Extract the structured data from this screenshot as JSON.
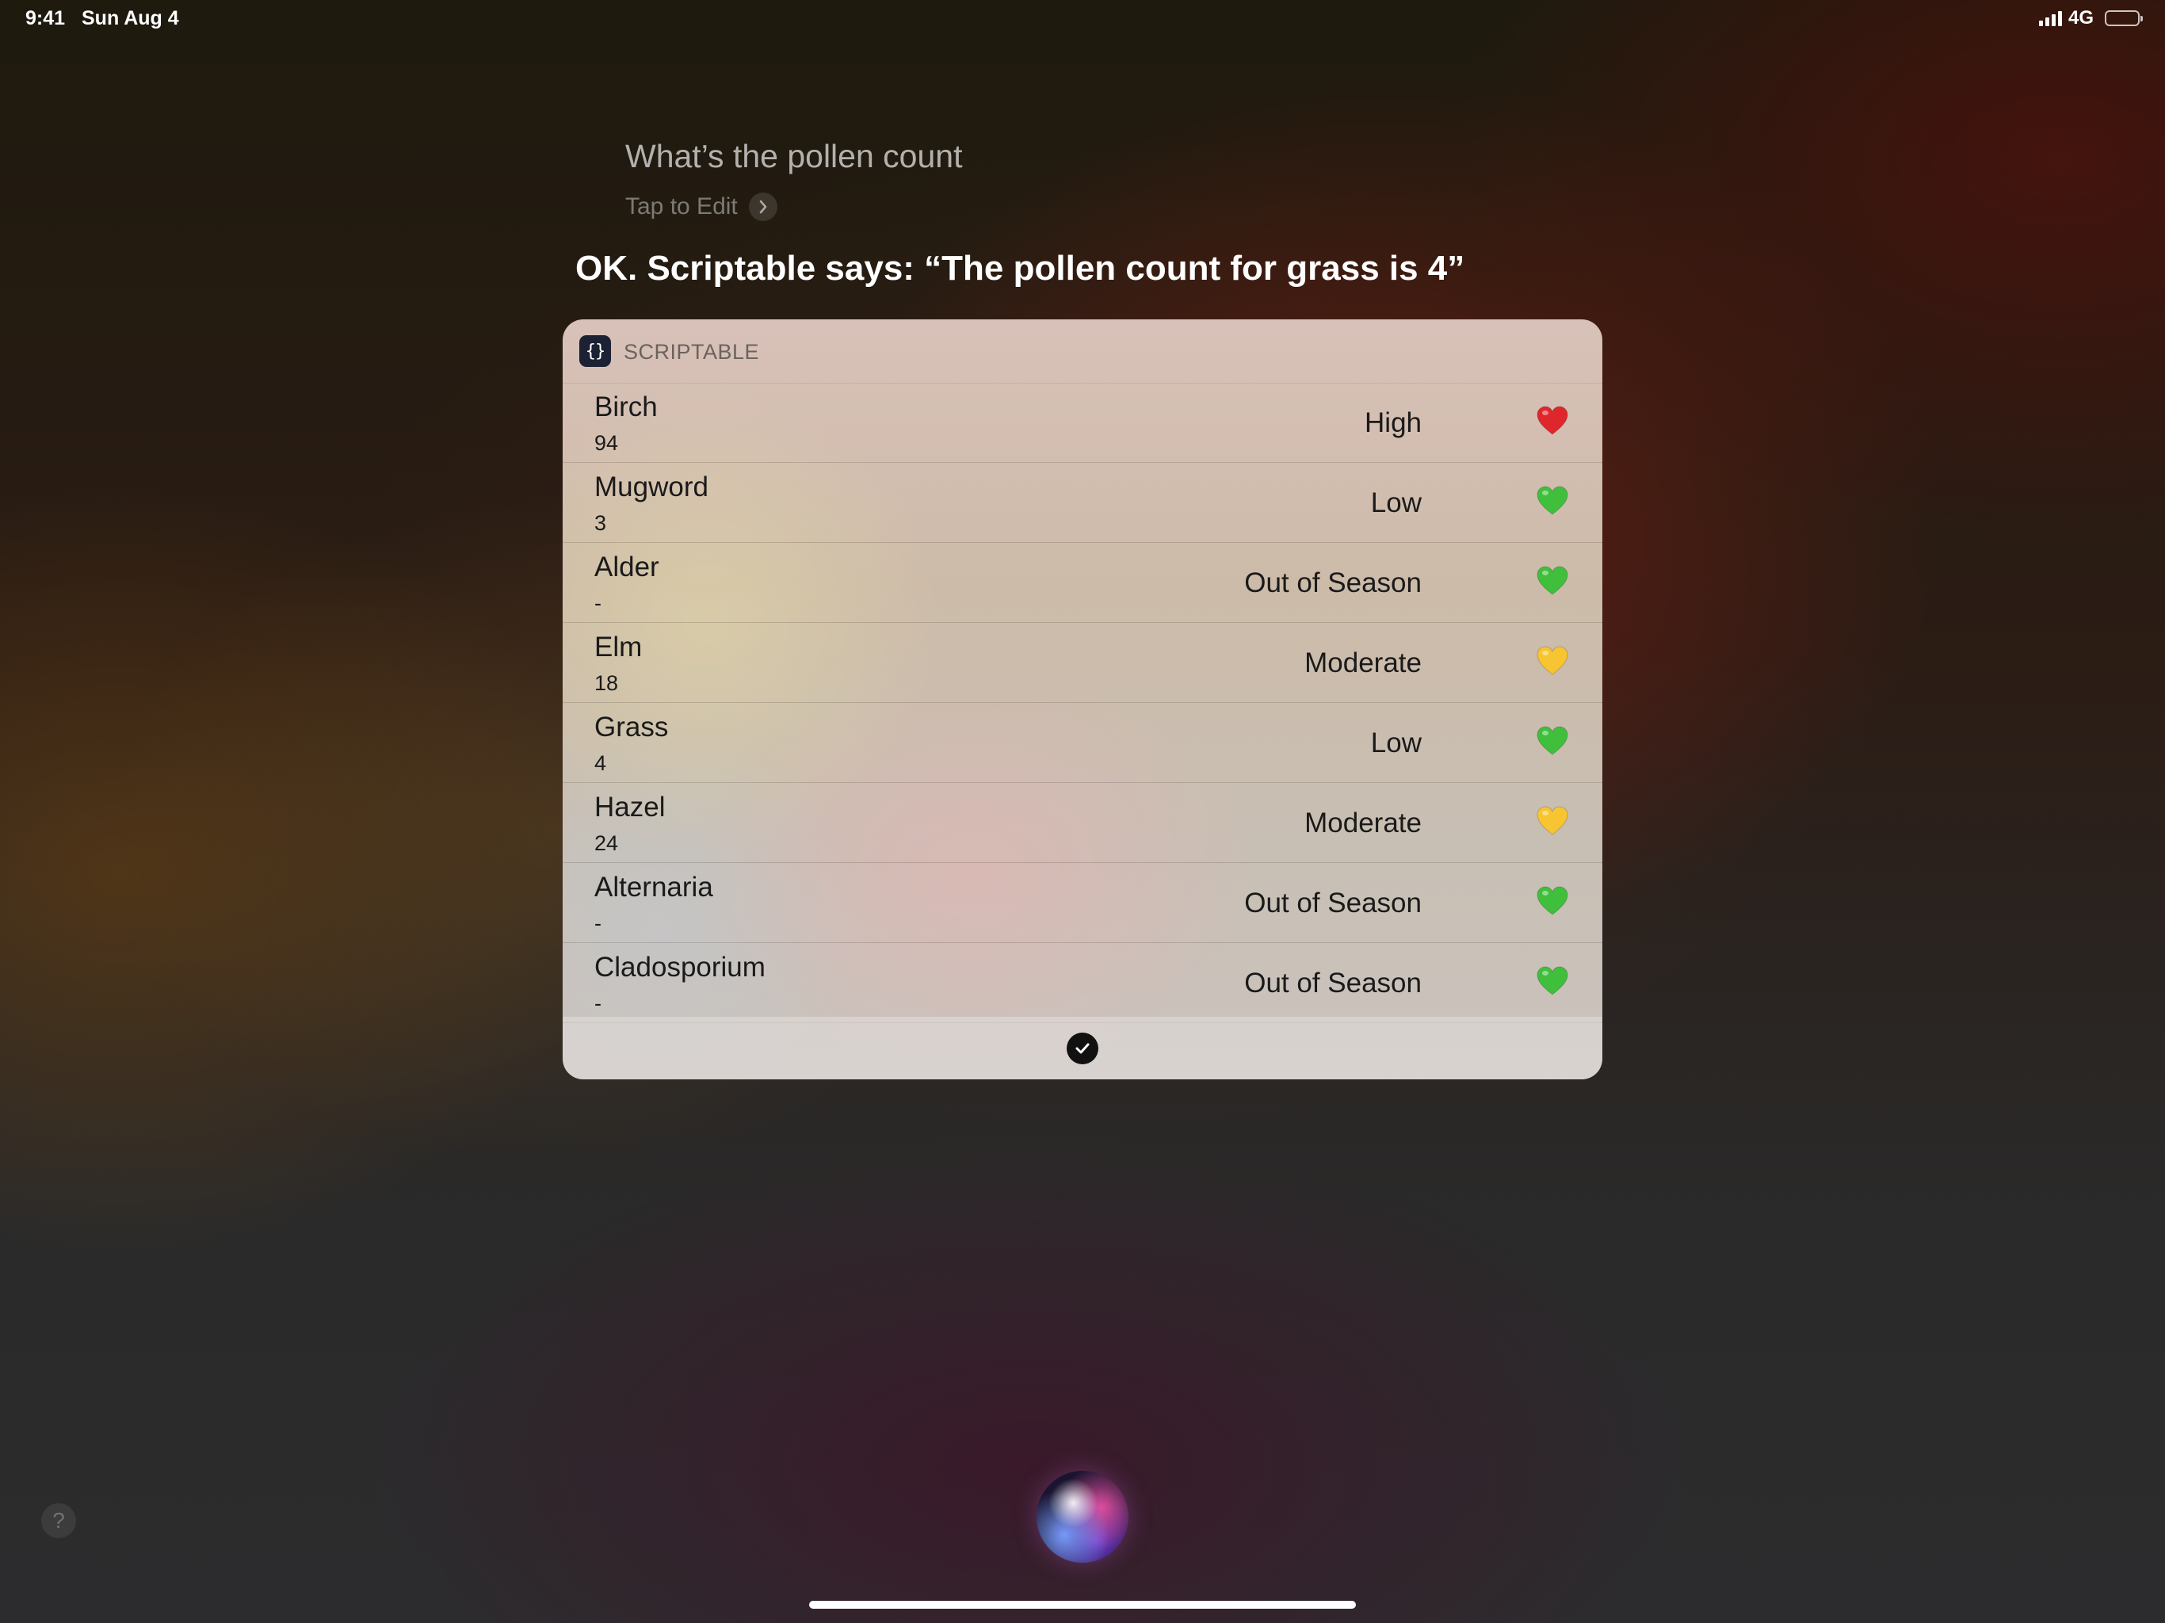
{
  "status_bar": {
    "time": "9:41",
    "date": "Sun Aug 4",
    "network": "4G",
    "battery": 1.0
  },
  "siri": {
    "query": "What’s the pollen count",
    "tap_to_edit": "Tap to Edit",
    "response": "OK. Scriptable says: “The pollen count for grass is 4”"
  },
  "card": {
    "app_name": "SCRIPTABLE",
    "app_icon_glyph": "{}",
    "rows": [
      {
        "name": "Birch",
        "count": "94",
        "level": "High",
        "heart": "red-heart-icon",
        "color": "#e0262d"
      },
      {
        "name": "Mugword",
        "count": "3",
        "level": "Low",
        "heart": "green-heart-icon",
        "color": "#3fbf3b"
      },
      {
        "name": "Alder",
        "count": "-",
        "level": "Out of Season",
        "heart": "green-heart-icon",
        "color": "#3fbf3b"
      },
      {
        "name": "Elm",
        "count": "18",
        "level": "Moderate",
        "heart": "yellow-heart-icon",
        "color": "#f7c531"
      },
      {
        "name": "Grass",
        "count": "4",
        "level": "Low",
        "heart": "green-heart-icon",
        "color": "#3fbf3b"
      },
      {
        "name": "Hazel",
        "count": "24",
        "level": "Moderate",
        "heart": "yellow-heart-icon",
        "color": "#f7c531"
      },
      {
        "name": "Alternaria",
        "count": "-",
        "level": "Out of Season",
        "heart": "green-heart-icon",
        "color": "#3fbf3b"
      },
      {
        "name": "Cladosporium",
        "count": "-",
        "level": "Out of Season",
        "heart": "green-heart-icon",
        "color": "#3fbf3b"
      }
    ]
  },
  "help_label": "?"
}
